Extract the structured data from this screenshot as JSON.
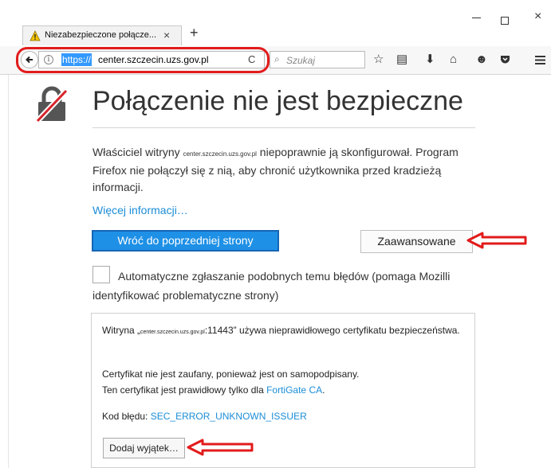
{
  "browser": {
    "tab_title": "Niezabezpieczone połącze...",
    "tab_close": "×",
    "new_tab": "+",
    "window_close": "×",
    "url_scheme": "https://",
    "url_host": "center.szczecin.uzs.gov.pl",
    "reload": "C",
    "search_placeholder": "Szukaj",
    "search_icon": "search-icon",
    "toolbar_icons": [
      "bookmark-star-icon",
      "reading-list-icon",
      "download-icon",
      "home-icon",
      "smiley-icon",
      "pocket-icon",
      "menu-icon"
    ]
  },
  "page": {
    "title": "Połączenie nie jest bezpieczne",
    "desc_before": "Właściciel witryny ",
    "desc_host": "center.szczecin.uzs.gov.pl",
    "desc_after": " niepoprawnie ją skonfigurował. Program Firefox nie połączył się z nią, aby chronić użytkownika przed kradzieżą informacji.",
    "more_info": "Więcej informacji…",
    "back_button": "Wróć do poprzedniej strony",
    "advanced_button": "Zaawansowane",
    "report_checkbox_label": "Automatyczne zgłaszanie podobnych temu błędów (pomaga Mozilli identyfikować problematyczne strony)"
  },
  "advanced": {
    "p1_before": "Witryna „",
    "p1_host": "center.szczecin.uzs.gov.pl",
    "p1_after": ":11443” używa nieprawidłowego certyfikatu bezpieczeństwa.",
    "p2_line1": "Certyfikat nie jest zaufany, ponieważ jest on samopodpisany.",
    "p2_line2_before": "Ten certyfikat jest prawidłowy tylko dla ",
    "p2_issuer": "FortiGate CA",
    "p2_line2_after": ".",
    "error_label": "Kod błędu: ",
    "error_code": "SEC_ERROR_UNKNOWN_ISSUER",
    "add_exception_button": "Dodaj wyjątek…"
  },
  "colors": {
    "annotation_red": "#e21b1b",
    "primary_button": "#1e90e6",
    "link": "#1b8dd6"
  }
}
